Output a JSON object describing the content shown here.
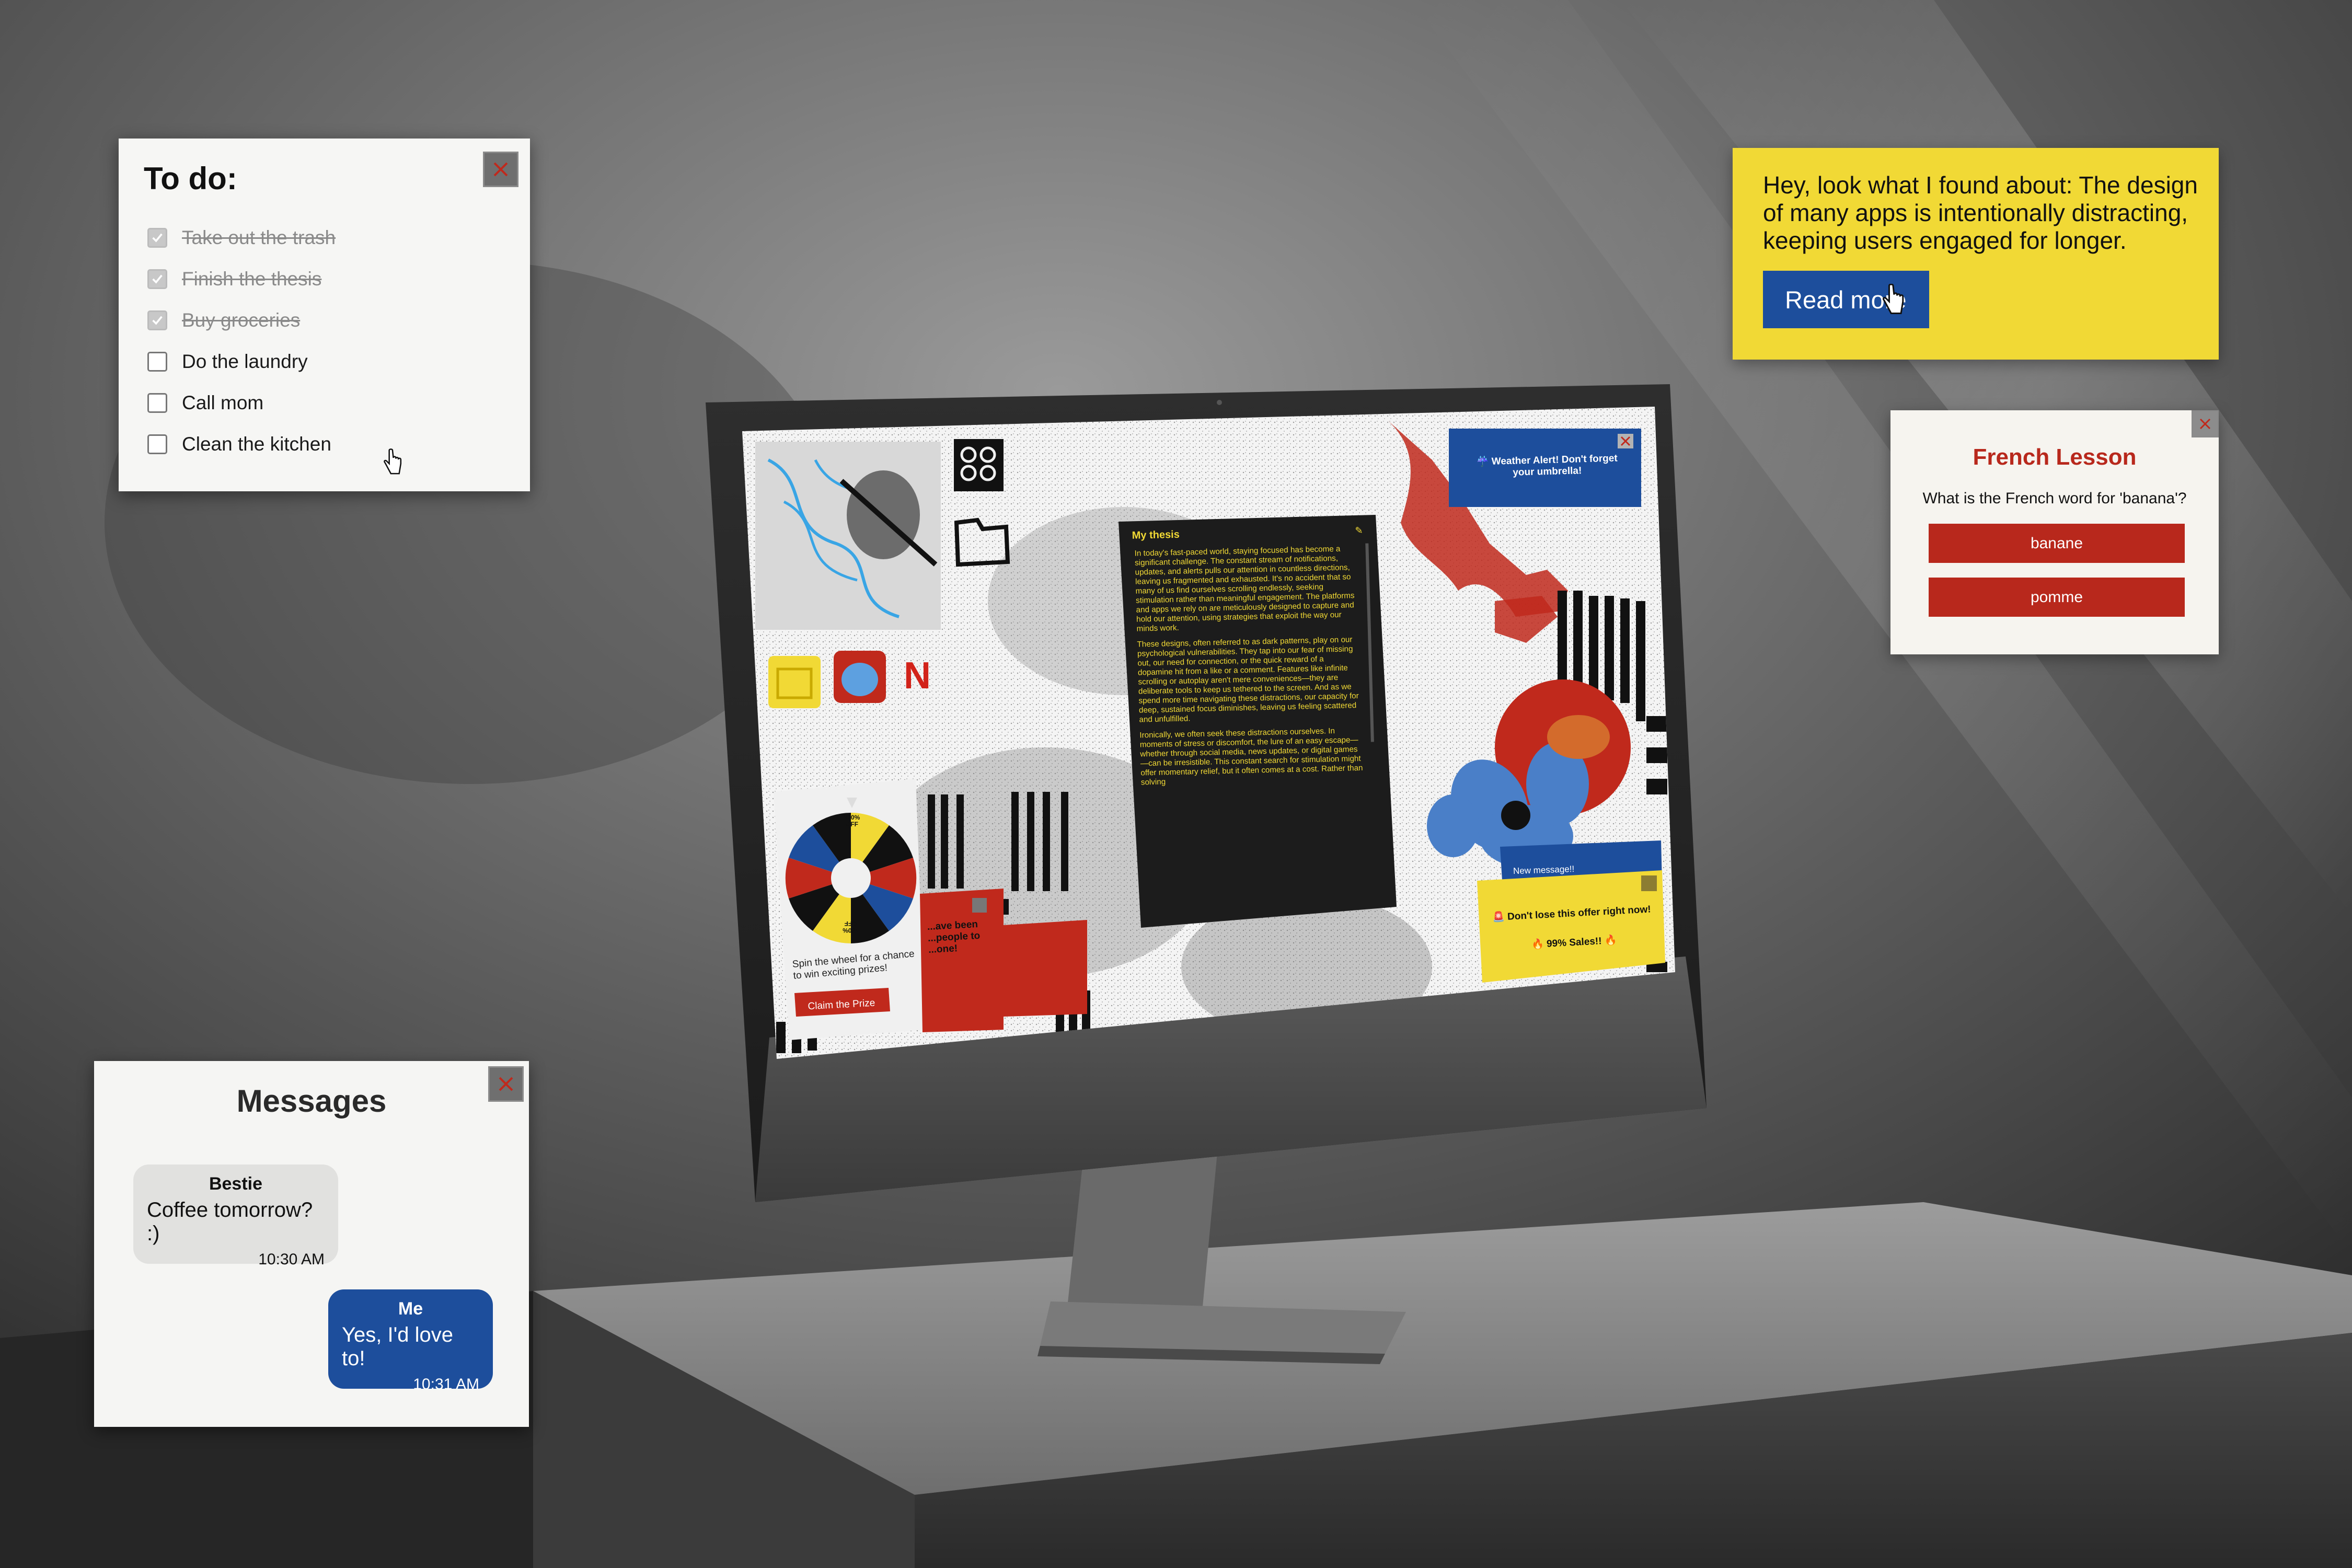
{
  "todo": {
    "title": "To do:",
    "items": [
      {
        "label": "Take out the trash",
        "done": true
      },
      {
        "label": "Finish the thesis",
        "done": true
      },
      {
        "label": "Buy groceries",
        "done": true
      },
      {
        "label": "Do the laundry",
        "done": false
      },
      {
        "label": "Call mom",
        "done": false
      },
      {
        "label": "Clean the kitchen",
        "done": false
      }
    ]
  },
  "readmore": {
    "message": "Hey, look what I found about: The design of many apps is intentionally distracting, keeping users engaged for longer.",
    "button_label": "Read more"
  },
  "french": {
    "title": "French Lesson",
    "question": "What is the French word for 'banana'?",
    "options": [
      "banane",
      "pomme"
    ]
  },
  "messages": {
    "title": "Messages",
    "thread": [
      {
        "sender": "Bestie",
        "text": "Coffee tomorrow? :)",
        "time": "10:30 AM"
      },
      {
        "sender": "Me",
        "text": "Yes, I'd love to!",
        "time": "10:31 AM"
      }
    ]
  },
  "screen": {
    "weather_alert": "☔ Weather Alert! Don't forget your umbrella!",
    "thesis": {
      "title": "My thesis",
      "paragraphs": [
        "In today's fast-paced world, staying focused has become a significant challenge. The constant stream of notifications, updates, and alerts pulls our attention in countless directions, leaving us fragmented and exhausted. It's no accident that so many of us find ourselves scrolling endlessly, seeking stimulation rather than meaningful engagement. The platforms and apps we rely on are meticulously designed to capture and hold our attention, using strategies that exploit the way our minds work.",
        "These designs, often referred to as dark patterns, play on our psychological vulnerabilities. They tap into our fear of missing out, our need for connection, or the quick reward of a dopamine hit from a like or a comment. Features like infinite scrolling or autoplay aren't mere conveniences—they are deliberate tools to keep us tethered to the screen. And as we spend more time navigating these distractions, our capacity for deep, sustained focus diminishes, leaving us feeling scattered and unfulfilled.",
        "Ironically, we often seek these distractions ourselves. In moments of stress or discomfort, the lure of an easy escape—whether through social media, news updates, or digital games—can be irresistible. This constant search for stimulation might offer momentary relief, but it often comes at a cost. Rather than solving"
      ]
    },
    "wheel": {
      "labels": [
        "100% OFF",
        "5% OFF",
        "10% OFF",
        "50% OFF",
        "10% OFF",
        "50% OFF",
        "100% OFF",
        "5% OFF",
        "50% OFF",
        "10% OFF"
      ],
      "caption": "Spin the wheel for a chance to win exciting prizes!",
      "button_label": "Claim the Prize"
    },
    "partial_popup": "...ave been ...people to ...one!",
    "new_message": "New message!!",
    "offer": {
      "line1": "🚨 Don't lose this offer right now!",
      "line2": "🔥 99% Sales!! 🔥"
    },
    "app_icons": [
      "calendar-app",
      "cat-game-app",
      "netflix-app"
    ],
    "netflix_letter": "N"
  },
  "colors": {
    "accent_blue": "#1d4e9c",
    "accent_red": "#b8281c",
    "accent_yellow": "#f1d935"
  }
}
